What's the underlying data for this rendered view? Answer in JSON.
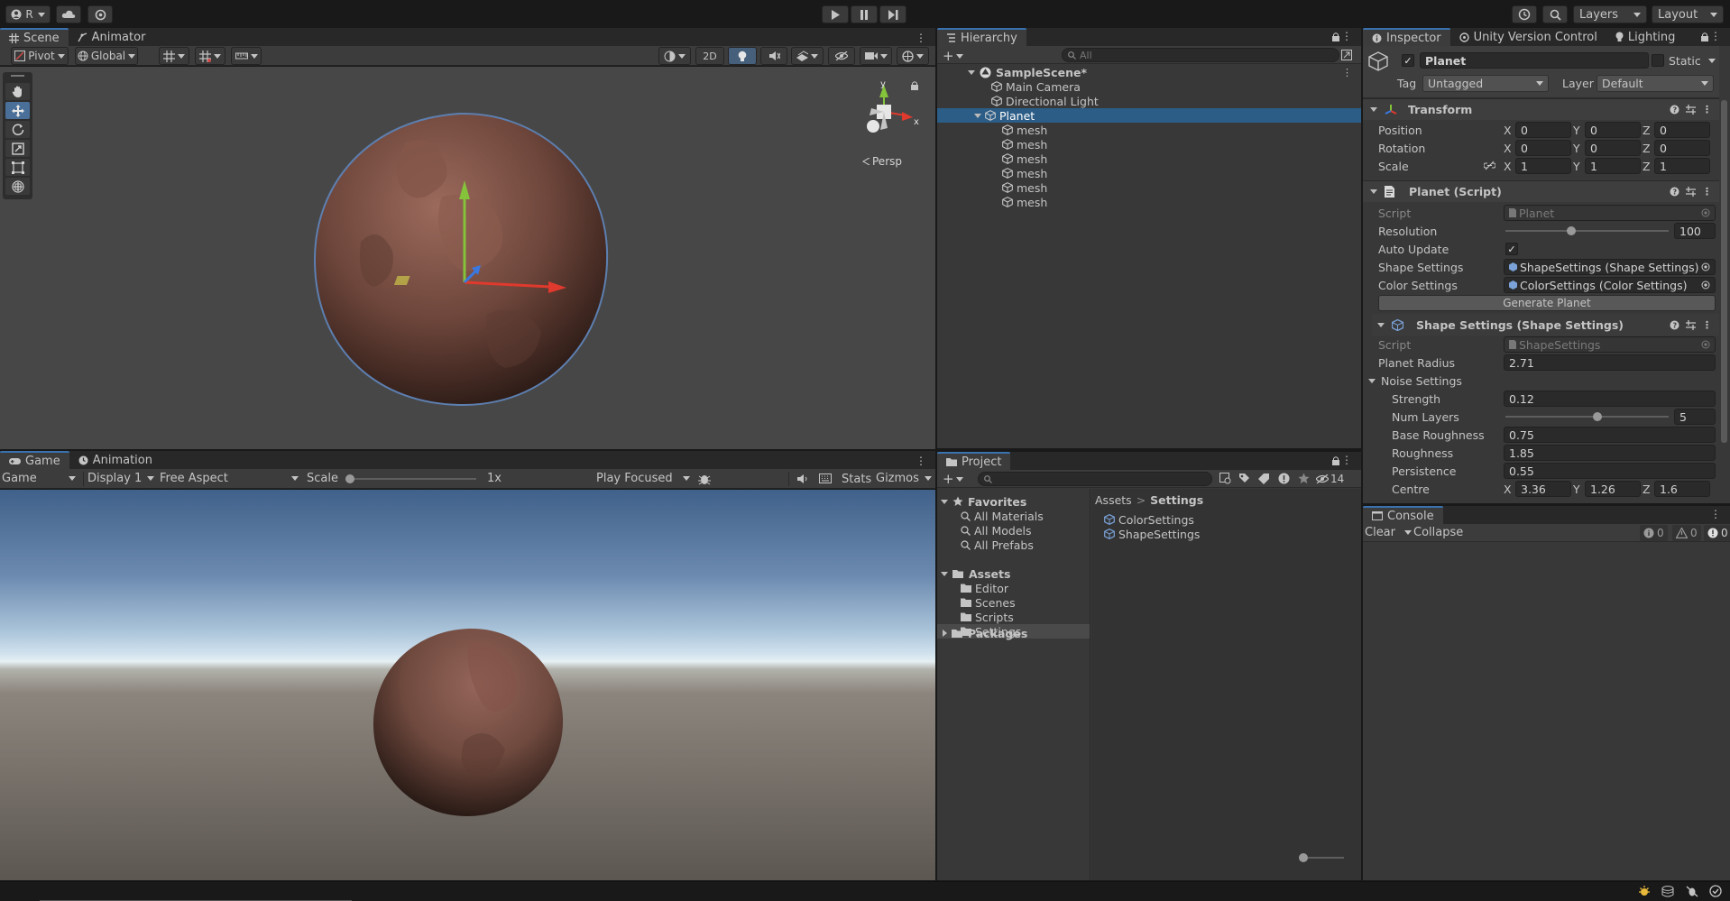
{
  "toolbar": {
    "account": "R",
    "layers": "Layers",
    "layout": "Layout"
  },
  "scene": {
    "tabs": [
      "Scene",
      "Animator"
    ],
    "pivot": "Pivot",
    "global": "Global",
    "mode_2d": "2D",
    "persp": "Persp",
    "gizmo_y": "y",
    "gizmo_x": "x"
  },
  "game": {
    "tabs": [
      "Game",
      "Animation"
    ],
    "game_dropdown": "Game",
    "display": "Display 1",
    "aspect": "Free Aspect",
    "scale_label": "Scale",
    "scale_value": "1x",
    "play_focused": "Play Focused",
    "stats": "Stats",
    "gizmos": "Gizmos",
    "scale_slider": 0.0
  },
  "hierarchy": {
    "tab": "Hierarchy",
    "search_placeholder": "All",
    "scene_name": "SampleScene*",
    "items": [
      {
        "label": "Main Camera",
        "depth": 1
      },
      {
        "label": "Directional Light",
        "depth": 1
      },
      {
        "label": "Planet",
        "depth": 1,
        "selected": true
      },
      {
        "label": "mesh",
        "depth": 2
      },
      {
        "label": "mesh",
        "depth": 2
      },
      {
        "label": "mesh",
        "depth": 2
      },
      {
        "label": "mesh",
        "depth": 2
      },
      {
        "label": "mesh",
        "depth": 2
      },
      {
        "label": "mesh",
        "depth": 2
      }
    ]
  },
  "project": {
    "tab": "Project",
    "hidden_count": "14",
    "favorites": "Favorites",
    "favorite_items": [
      "All Materials",
      "All Models",
      "All Prefabs"
    ],
    "assets": "Assets",
    "asset_folders": [
      "Editor",
      "Scenes",
      "Scripts",
      "Settings"
    ],
    "packages": "Packages",
    "breadcrumb_root": "Assets",
    "breadcrumb_current": "Settings",
    "files": [
      "ColorSettings",
      "ShapeSettings"
    ]
  },
  "inspector": {
    "tabs": [
      "Inspector",
      "Unity Version Control",
      "Lighting"
    ],
    "object_name": "Planet",
    "static_label": "Static",
    "tag_label": "Tag",
    "tag_value": "Untagged",
    "layer_label": "Layer",
    "layer_value": "Default",
    "transform": {
      "title": "Transform",
      "position_label": "Position",
      "rotation_label": "Rotation",
      "scale_label": "Scale",
      "position": [
        "0",
        "0",
        "0"
      ],
      "rotation": [
        "0",
        "0",
        "0"
      ],
      "scale": [
        "1",
        "1",
        "1"
      ]
    },
    "planet_script": {
      "title": "Planet (Script)",
      "script_label": "Script",
      "script_value": "Planet",
      "resolution_label": "Resolution",
      "resolution_value": "100",
      "resolution_fraction": 0.4,
      "auto_update_label": "Auto Update",
      "shape_label": "Shape Settings",
      "shape_value": "ShapeSettings (Shape Settings)",
      "color_label": "Color Settings",
      "color_value": "ColorSettings (Color Settings)",
      "generate_button": "Generate Planet"
    },
    "shape_settings": {
      "title": "Shape Settings (Shape Settings)",
      "script_label": "Script",
      "script_value": "ShapeSettings",
      "radius_label": "Planet Radius",
      "radius_value": "2.71",
      "noise_label": "Noise Settings",
      "strength_label": "Strength",
      "strength_value": "0.12",
      "layers_label": "Num Layers",
      "layers_value": "5",
      "layers_fraction": 0.57,
      "base_rough_label": "Base Roughness",
      "base_rough_value": "0.75",
      "rough_label": "Roughness",
      "rough_value": "1.85",
      "persist_label": "Persistence",
      "persist_value": "0.55",
      "centre_label": "Centre",
      "centre": [
        "3.36",
        "1.26",
        "1.6"
      ]
    },
    "axis": [
      "X",
      "Y",
      "Z"
    ]
  },
  "console": {
    "tab": "Console",
    "clear": "Clear",
    "collapse": "Collapse",
    "counts": [
      "0",
      "0",
      "0"
    ]
  },
  "colors": {
    "accent": "#3a72b0",
    "selection": "#2c5d87",
    "planet": "#7a4e42"
  }
}
